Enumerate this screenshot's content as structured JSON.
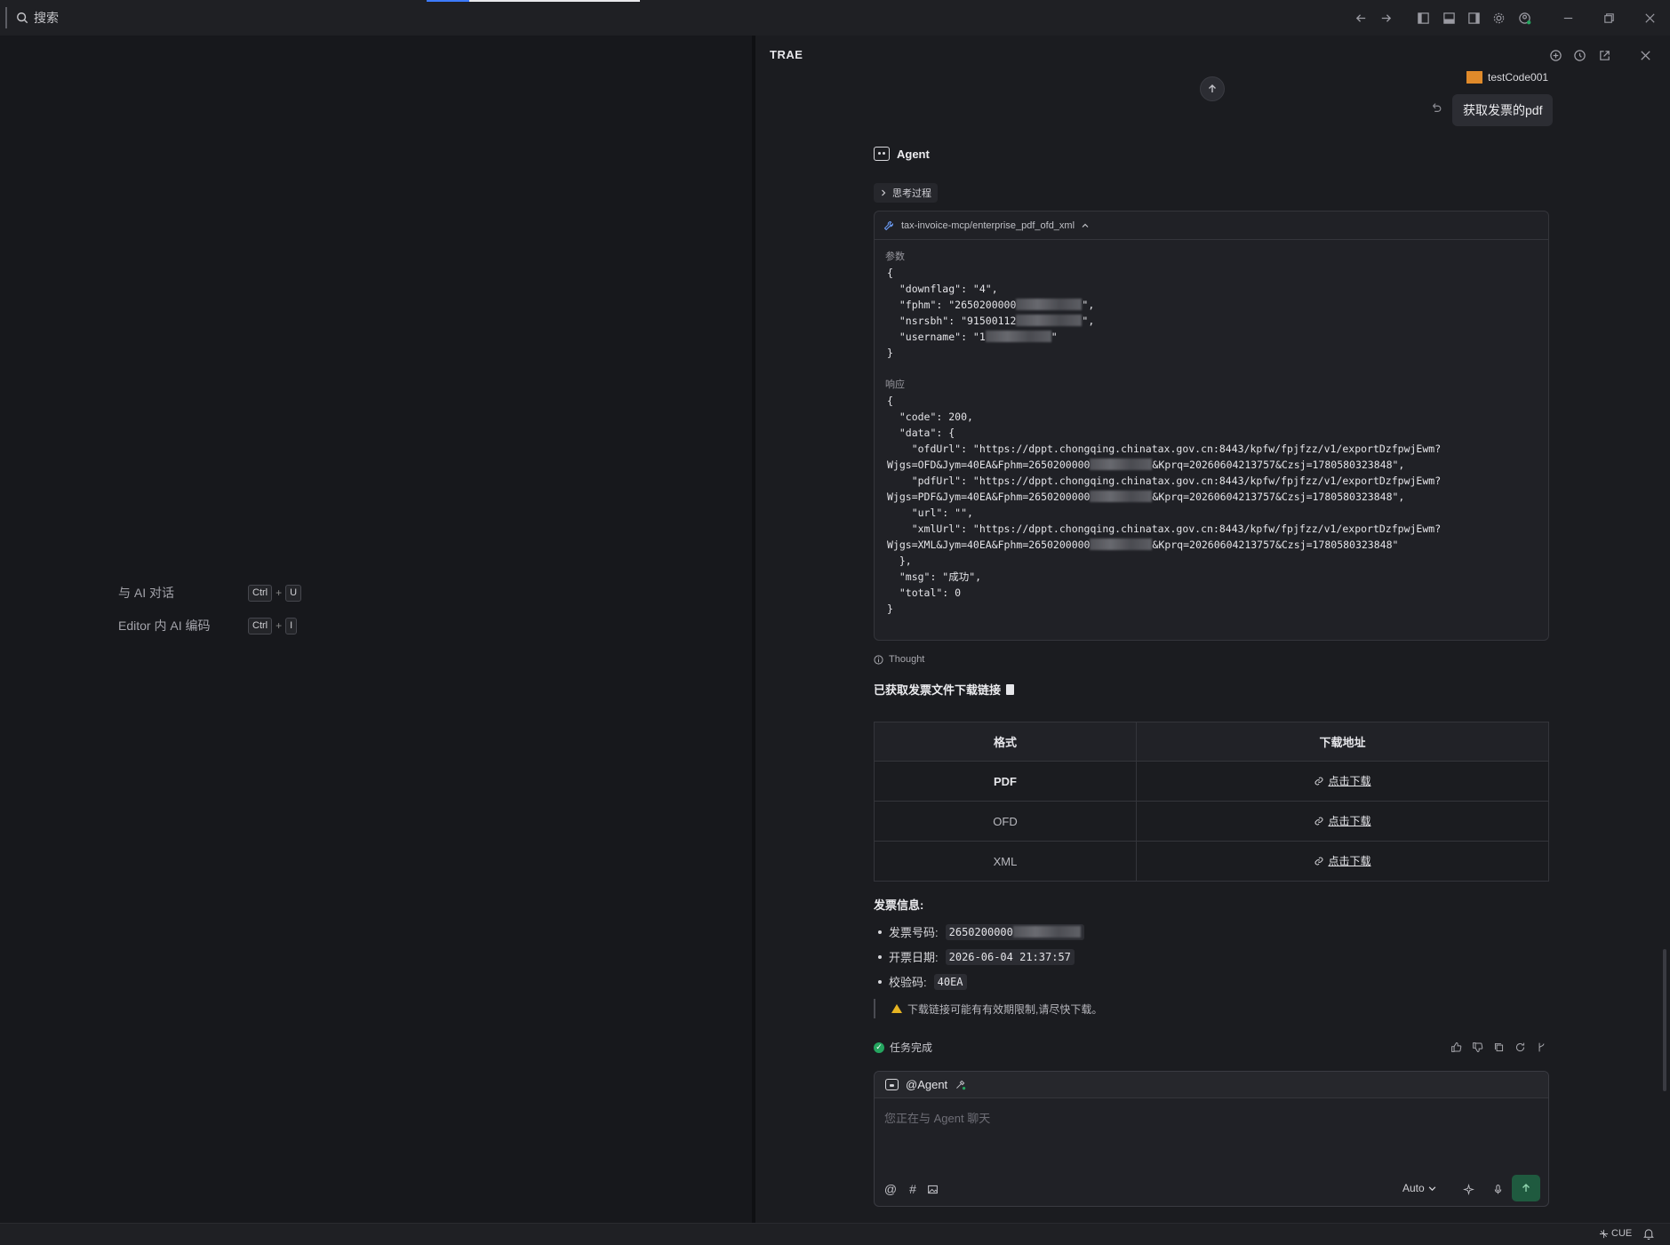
{
  "titlebar": {
    "search_label": "搜索",
    "icons": [
      "arrow-left-icon",
      "arrow-right-icon",
      "layout-left-icon",
      "layout-bottom-icon",
      "layout-right-icon",
      "settings-icon",
      "account-icon",
      "minimize-icon",
      "restore-icon",
      "close-icon"
    ]
  },
  "editor": {
    "shortcuts": [
      {
        "label": "与 AI 对话",
        "key1": "Ctrl",
        "plus": "+",
        "key2": "U"
      },
      {
        "label": "Editor 内 AI 编码",
        "key1": "Ctrl",
        "plus": "+",
        "key2": "I"
      }
    ]
  },
  "panel": {
    "title": "TRAE",
    "user_name": "testCode001",
    "user_message": "获取发票的pdf",
    "agent_label": "Agent",
    "thinking_label": "思考过程",
    "tool": {
      "name": "tax-invoice-mcp/enterprise_pdf_ofd_xml",
      "params_label": "参数",
      "params": {
        "open": "{",
        "downflag": "  \"downflag\": \"4\",",
        "fphm_pre": "  \"fphm\": \"2650200000",
        "fphm_post": "\",",
        "nsrsbh_pre": "  \"nsrsbh\": \"91500112",
        "nsrsbh_post": "\",",
        "username_pre": "  \"username\": \"1",
        "username_post": "\"",
        "close": "}"
      },
      "response_label": "响应",
      "response": {
        "l1": "{",
        "l2": "  \"code\": 200,",
        "l3": "  \"data\": {",
        "l4": "    \"ofdUrl\": \"https://dppt.chongqing.chinatax.gov.cn:8443/kpfw/fpjfzz/v1/exportDzfpwjEwm?",
        "l5_pre": "Wjgs=OFD&Jym=40EA&Fphm=2650200000",
        "l5_post": "&Kprq=20260604213757&Czsj=1780580323848\",",
        "l6": "    \"pdfUrl\": \"https://dppt.chongqing.chinatax.gov.cn:8443/kpfw/fpjfzz/v1/exportDzfpwjEwm?",
        "l7_pre": "Wjgs=PDF&Jym=40EA&Fphm=2650200000",
        "l7_post": "&Kprq=20260604213757&Czsj=1780580323848\",",
        "l8": "    \"url\": \"\",",
        "l9": "    \"xmlUrl\": \"https://dppt.chongqing.chinatax.gov.cn:8443/kpfw/fpjfzz/v1/exportDzfpwjEwm?",
        "l10_pre": "Wjgs=XML&Jym=40EA&Fphm=2650200000",
        "l10_post": "&Kprq=20260604213757&Czsj=1780580323848\"",
        "l11": "  },",
        "l12": "  \"msg\": \"成功\",",
        "l13": "  \"total\": 0",
        "l14": "}"
      }
    },
    "thought_label": "Thought",
    "result_title": "已获取发票文件下载链接",
    "table": {
      "headers": [
        "格式",
        "下载地址"
      ],
      "rows": [
        {
          "format": "PDF",
          "link": "点击下载"
        },
        {
          "format": "OFD",
          "link": "点击下载"
        },
        {
          "format": "XML",
          "link": "点击下载"
        }
      ]
    },
    "info": {
      "title": "发票信息:",
      "invoice_no_label": "发票号码:",
      "invoice_no": "2650200000",
      "date_label": "开票日期:",
      "date": "2026-06-04 21:37:57",
      "check_label": "校验码:",
      "check": "40EA"
    },
    "warning": "下载链接可能有有效期限制,请尽快下载。",
    "done_label": "任务完成",
    "composer": {
      "agent_tag": "@Agent",
      "placeholder": "您正在与 Agent 聊天",
      "model": "Auto"
    }
  },
  "statusbar": {
    "cue": "CUE"
  }
}
